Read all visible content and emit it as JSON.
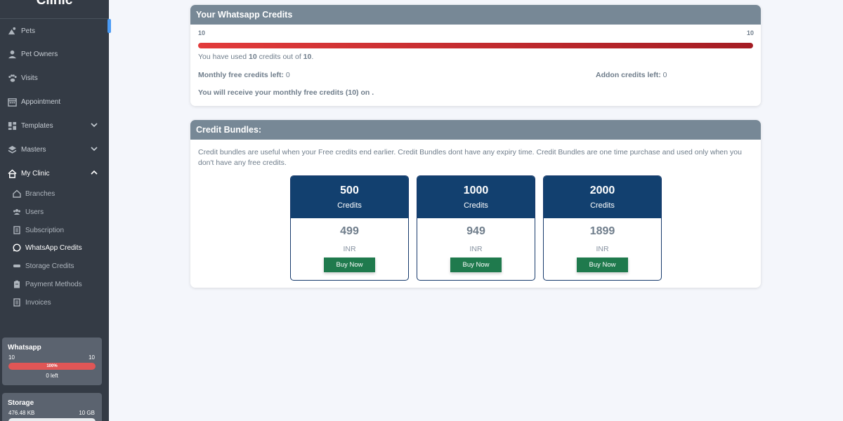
{
  "sidebar": {
    "brand": "Clinic",
    "items": [
      {
        "label": "Pets",
        "icon": "paw-house-icon"
      },
      {
        "label": "Pet Owners",
        "icon": "user-icon"
      },
      {
        "label": "Visits",
        "icon": "paw-icon"
      },
      {
        "label": "Appointment",
        "icon": "calendar-icon"
      },
      {
        "label": "Templates",
        "icon": "grid-icon"
      },
      {
        "label": "Masters",
        "icon": "layers-icon"
      },
      {
        "label": "My Clinic",
        "icon": "home-icon"
      }
    ],
    "subitems": [
      {
        "label": "Branches",
        "icon": "branch-icon"
      },
      {
        "label": "Users",
        "icon": "users-icon"
      },
      {
        "label": "Subscription",
        "icon": "document-icon"
      },
      {
        "label": "WhatsApp Credits",
        "icon": "whatsapp-icon"
      },
      {
        "label": "Storage Credits",
        "icon": "storage-icon"
      },
      {
        "label": "Payment Methods",
        "icon": "clipboard-icon"
      },
      {
        "label": "Invoices",
        "icon": "invoice-icon"
      }
    ],
    "whatsapp_card": {
      "title": "Whatsapp",
      "min": "10",
      "max": "10",
      "percent_label": "100%",
      "left": "0 left",
      "fraction": 1.0
    },
    "storage_card": {
      "title": "Storage",
      "used": "476.48 KB",
      "total": "10 GB"
    }
  },
  "credits": {
    "title": "Your Whatsapp Credits",
    "min_label": "10",
    "max_label": "10",
    "used_pre": "You have used ",
    "used": "10",
    "used_mid": " credits out of ",
    "total": "10",
    "used_post": ".",
    "monthly_label": "Monthly free credits left:",
    "monthly_value": " 0",
    "addon_label": "Addon credits left:",
    "addon_value": " 0",
    "receive_text": "You will receive your monthly free credits (10) on ."
  },
  "bundles": {
    "title": "Credit Bundles:",
    "description": "Credit bundles are useful when your Free credits end earlier. Credit Bundles dont have any expiry time. Credit Bundles are one time purchase and used only when you don't have any free credits.",
    "items": [
      {
        "credits": "500",
        "credits_label": "Credits",
        "price": "499",
        "currency": "INR",
        "buy": "Buy Now"
      },
      {
        "credits": "1000",
        "credits_label": "Credits",
        "price": "949",
        "currency": "INR",
        "buy": "Buy Now"
      },
      {
        "credits": "2000",
        "credits_label": "Credits",
        "price": "1899",
        "currency": "INR",
        "buy": "Buy Now"
      }
    ]
  },
  "colors": {
    "sidebar": "#343b45",
    "header": "#778896",
    "bundle_top": "#12406f",
    "buy": "#1f7a4d",
    "progress": "#e23b3b"
  }
}
